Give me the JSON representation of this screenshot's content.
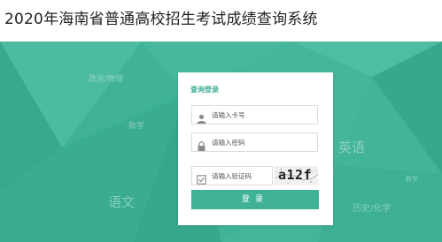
{
  "header": {
    "title": "2020年海南省普通高校招生考试成绩查询系统"
  },
  "background_words": [
    {
      "text": "政治/物理"
    },
    {
      "text": "数学"
    },
    {
      "text": "英语"
    },
    {
      "text": "语文"
    },
    {
      "text": "数学"
    },
    {
      "text": "历史/化学"
    }
  ],
  "login": {
    "title": "查询登录",
    "card_number_placeholder": "请输入卡号",
    "password_placeholder": "请输入密码",
    "captcha_placeholder": "请输入验证码",
    "captcha_text": "a12f",
    "submit_label": "登录"
  },
  "colors": {
    "accent": "#3fb296",
    "title_green": "#3fae93"
  },
  "icons": [
    "user-icon",
    "lock-icon",
    "verify-icon"
  ]
}
